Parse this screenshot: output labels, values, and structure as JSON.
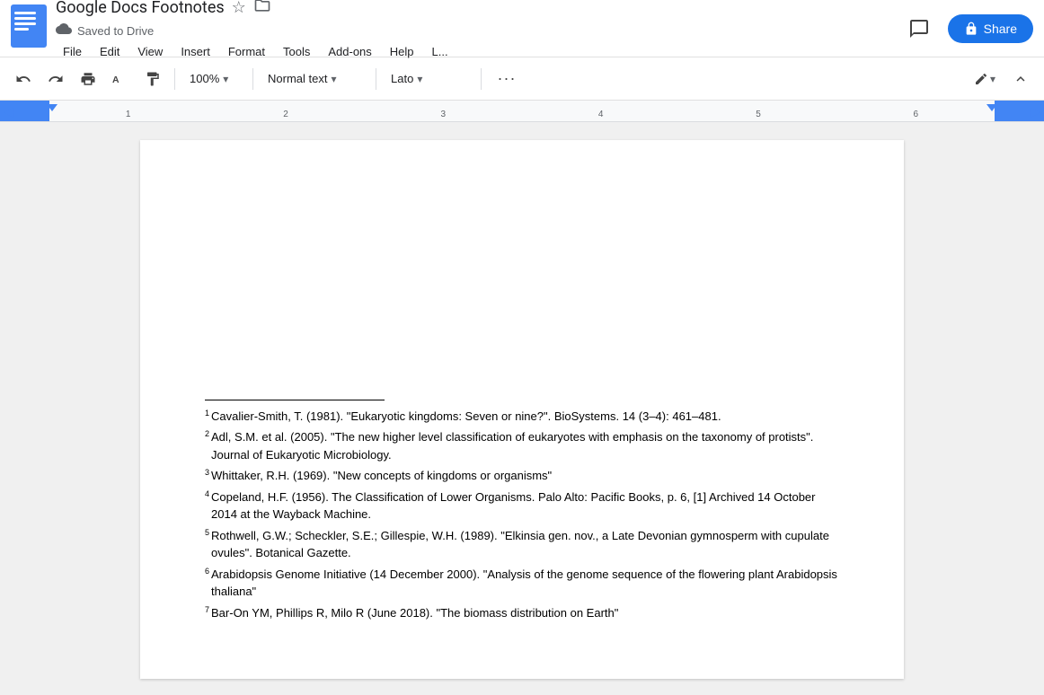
{
  "app": {
    "logo_alt": "Google Docs",
    "title": "Google Docs Footnotes"
  },
  "header": {
    "title": "Google Docs Footnotes",
    "star_icon": "☆",
    "folder_icon": "⊡",
    "saved_to_drive": "Saved to Drive",
    "cloud_icon": "☁",
    "menu_items": [
      "File",
      "Edit",
      "View",
      "Insert",
      "Format",
      "Tools",
      "Add-ons",
      "Help",
      "L..."
    ],
    "comments_icon": "💬",
    "share_label": "Share",
    "lock_icon": "🔒"
  },
  "toolbar": {
    "undo_icon": "↩",
    "redo_icon": "↪",
    "print_icon": "🖨",
    "paint_format_icon": "A",
    "copy_format_icon": "⊕",
    "zoom_value": "100%",
    "zoom_dropdown": "▾",
    "text_style": "Normal text",
    "text_style_dropdown": "▾",
    "font": "Lato",
    "font_dropdown": "▾",
    "more_icon": "···",
    "edit_icon": "✏",
    "edit_dropdown": "▾",
    "collapse_icon": "▲"
  },
  "ruler": {
    "marks": [
      "1",
      "2",
      "3",
      "4",
      "5",
      "6"
    ],
    "left_arrow": "◀",
    "right_arrow": "▶"
  },
  "footnotes": [
    {
      "num": "1",
      "text": "Cavalier-Smith, T. (1981). \"Eukaryotic kingdoms: Seven or nine?\". BioSystems. 14 (3–4): 461–481."
    },
    {
      "num": "2",
      "text": "Adl, S.M. et al. (2005). \"The new higher level classification of eukaryotes with emphasis on the taxonomy of protists\". Journal of Eukaryotic Microbiology."
    },
    {
      "num": "3",
      "text": "Whittaker, R.H. (1969). \"New concepts of kingdoms or organisms\""
    },
    {
      "num": "4",
      "text": "Copeland, H.F. (1956). The Classification of Lower Organisms. Palo Alto: Pacific Books, p. 6, [1] Archived 14 October 2014 at the Wayback Machine."
    },
    {
      "num": "5",
      "text": "Rothwell, G.W.; Scheckler, S.E.; Gillespie, W.H. (1989). \"Elkinsia gen. nov., a Late Devonian gymnosperm with cupulate ovules\". Botanical Gazette."
    },
    {
      "num": "6",
      "text": "Arabidopsis Genome Initiative (14 December 2000). \"Analysis of the genome sequence of the flowering plant Arabidopsis thaliana\""
    },
    {
      "num": "7",
      "text": "Bar-On YM, Phillips R, Milo R (June 2018). \"The biomass distribution on Earth\""
    }
  ]
}
